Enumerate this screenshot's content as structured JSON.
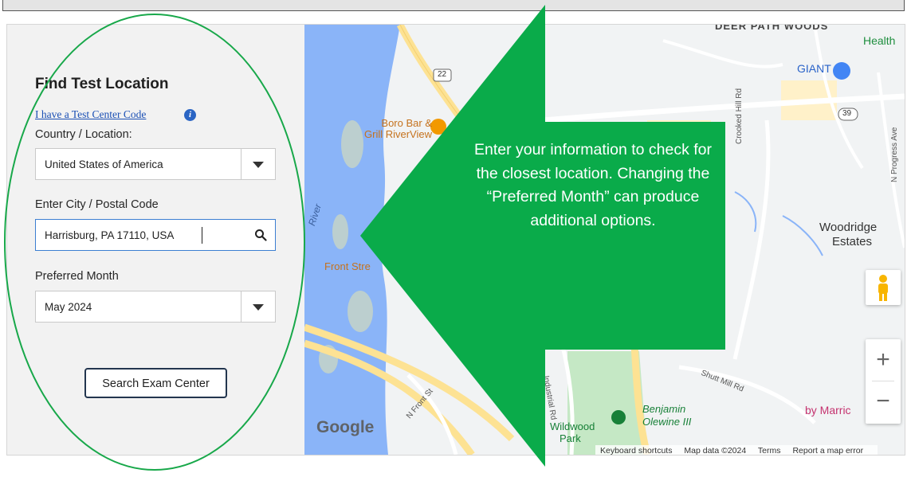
{
  "form": {
    "title": "Find Test Location",
    "code_link": "I have a Test Center Code",
    "country_label": "Country / Location:",
    "country_value": "United States of America",
    "city_label": "Enter City / Postal Code",
    "city_value": "Harrisburg, PA 17110, USA",
    "month_label": "Preferred Month",
    "month_value": "May 2024",
    "search_button": "Search Exam Center"
  },
  "map": {
    "labels": {
      "deer_path_woods": "DEER PATH WOODS",
      "health": "Health",
      "giant": "GIANT",
      "route_22": "22",
      "route_39": "39",
      "boro_bar": "Boro Bar &",
      "grill_riverview": "Grill RiverView",
      "crooked_hill_rd": "Crooked Hill Rd",
      "n_progress_ave": "N Progress Ave",
      "woodridge": "Woodridge",
      "estates": "Estates",
      "river": "River",
      "front_street": "Front Stre",
      "industrial_rd": "Industrial Rd",
      "n_front_st": "N Front St",
      "shutt_mill_rd": "Shutt Mill Rd",
      "benjamin": "Benjamin",
      "olewine": "Olewine III",
      "wildwood": "Wildwood",
      "park": "Park",
      "by_marriott": "by Marric",
      "google": "Google"
    },
    "attribution": {
      "keyboard": "Keyboard shortcuts",
      "mapdata": "Map data ©2024",
      "terms": "Terms",
      "report": "Report a map error"
    },
    "zoom_in": "+",
    "zoom_out": "−"
  },
  "callout": {
    "text": "Enter your information to check for the closest location. Changing the “Preferred Month” can produce additional options."
  },
  "colors": {
    "callout_green": "#0aab4a",
    "oval_green": "#18a84a",
    "water": "#8ab4f8",
    "road_yellow": "#fde293",
    "park_green": "#c5e8c5"
  }
}
